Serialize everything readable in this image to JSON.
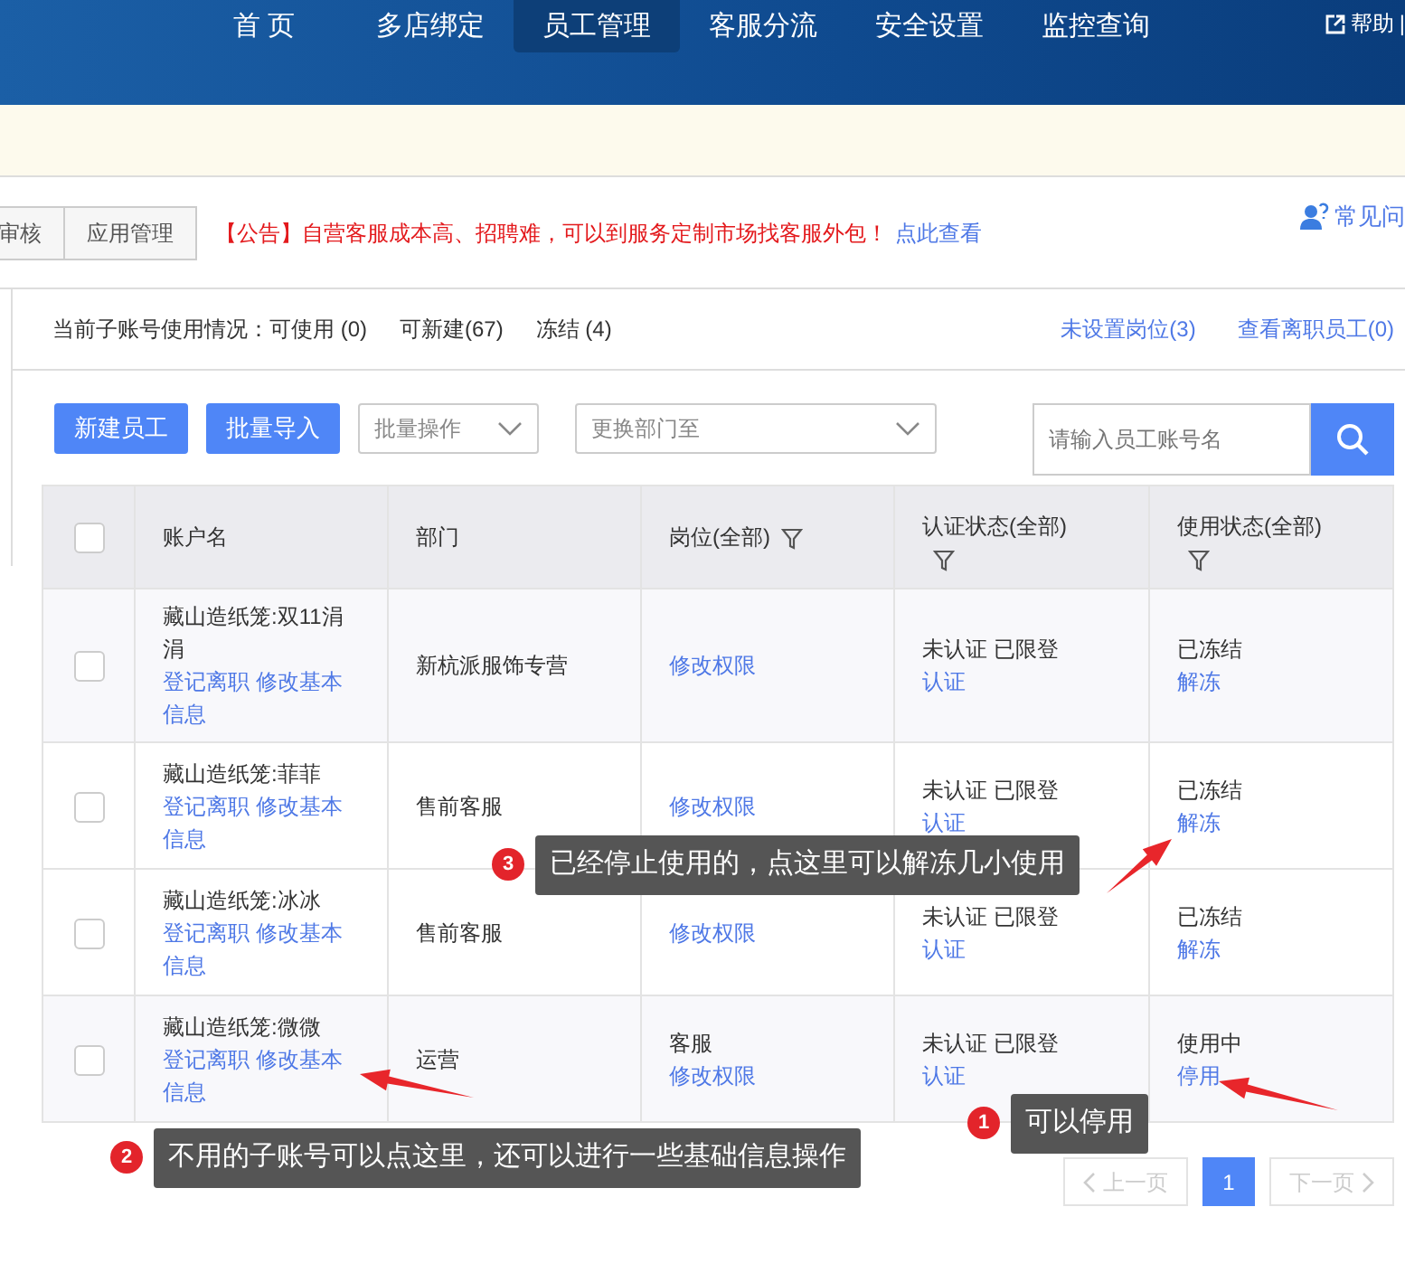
{
  "nav": {
    "items": [
      {
        "label": "首 页",
        "selected": false
      },
      {
        "label": "多店绑定",
        "selected": false
      },
      {
        "label": "员工管理",
        "selected": true
      },
      {
        "label": "客服分流",
        "selected": false
      },
      {
        "label": "安全设置",
        "selected": false
      },
      {
        "label": "监控查询",
        "selected": false
      }
    ],
    "help": "帮助",
    "separator": "|"
  },
  "tabs": [
    {
      "label": "审核",
      "selected": false
    },
    {
      "label": "应用管理",
      "selected": false
    }
  ],
  "announcement": {
    "tag": "【公告】",
    "text": "自营客服成本高、招聘难，可以到服务定制市场找客服外包！",
    "link": "点此查看"
  },
  "faq": "常见问",
  "stats": {
    "label": "当前子账号使用情况：",
    "items": [
      "可使用 (0)",
      "可新建(67)",
      "冻结 (4)"
    ],
    "links": [
      "未设置岗位(3)",
      "查看离职员工(0)"
    ]
  },
  "toolbar": {
    "buttons": [
      "新建员工",
      "批量导入"
    ],
    "selects": [
      "批量操作",
      "更换部门至"
    ],
    "search": {
      "placeholder": "请输入员工账号名"
    }
  },
  "table": {
    "all_checked": false,
    "columns": [
      {
        "label": "账户名",
        "filter": false
      },
      {
        "label": "部门",
        "filter": false
      },
      {
        "label": "岗位(全部)",
        "filter": true
      },
      {
        "label": "认证状态(全部)",
        "filter": true
      },
      {
        "label": "使用状态(全部)",
        "filter": true
      }
    ],
    "rows": [
      {
        "checked": false,
        "account": "藏山造纸笼:双11涓涓",
        "actions": [
          "登记离职",
          "修改基本信息"
        ],
        "department": "新杭派服饰专营",
        "role": "",
        "role_link": "修改权限",
        "auth": "未认证 已限登",
        "auth_link": "认证",
        "use_status": "已冻结",
        "use_link": "解冻"
      },
      {
        "checked": false,
        "account": "藏山造纸笼:菲菲",
        "actions": [
          "登记离职",
          "修改基本信息"
        ],
        "department": "售前客服",
        "role": "",
        "role_link": "修改权限",
        "auth": "未认证 已限登",
        "auth_link": "认证",
        "use_status": "已冻结",
        "use_link": "解冻"
      },
      {
        "checked": false,
        "account": "藏山造纸笼:冰冰",
        "actions": [
          "登记离职",
          "修改基本信息"
        ],
        "department": "售前客服",
        "role": "",
        "role_link": "修改权限",
        "auth": "未认证 已限登",
        "auth_link": "认证",
        "use_status": "已冻结",
        "use_link": "解冻"
      },
      {
        "checked": false,
        "account": "藏山造纸笼:微微",
        "actions": [
          "登记离职",
          "修改基本信息"
        ],
        "department": "运营",
        "role": "客服",
        "role_link": "修改权限",
        "auth": "未认证 已限登",
        "auth_link": "认证",
        "use_status": "使用中",
        "use_link": "停用"
      }
    ]
  },
  "pagination": {
    "prev": {
      "label": "上一页",
      "disabled": true
    },
    "pages": [
      {
        "label": "1",
        "selected": true
      }
    ],
    "next": {
      "label": "下一页",
      "disabled": true
    }
  },
  "annotations": [
    {
      "number": "3",
      "text": "已经停止使用的，点这里可以解冻几小使用"
    },
    {
      "number": "1",
      "text": "可以停用"
    },
    {
      "number": "2",
      "text": "不用的子账号可以点这里，还可以进行一些基础信息操作"
    }
  ]
}
